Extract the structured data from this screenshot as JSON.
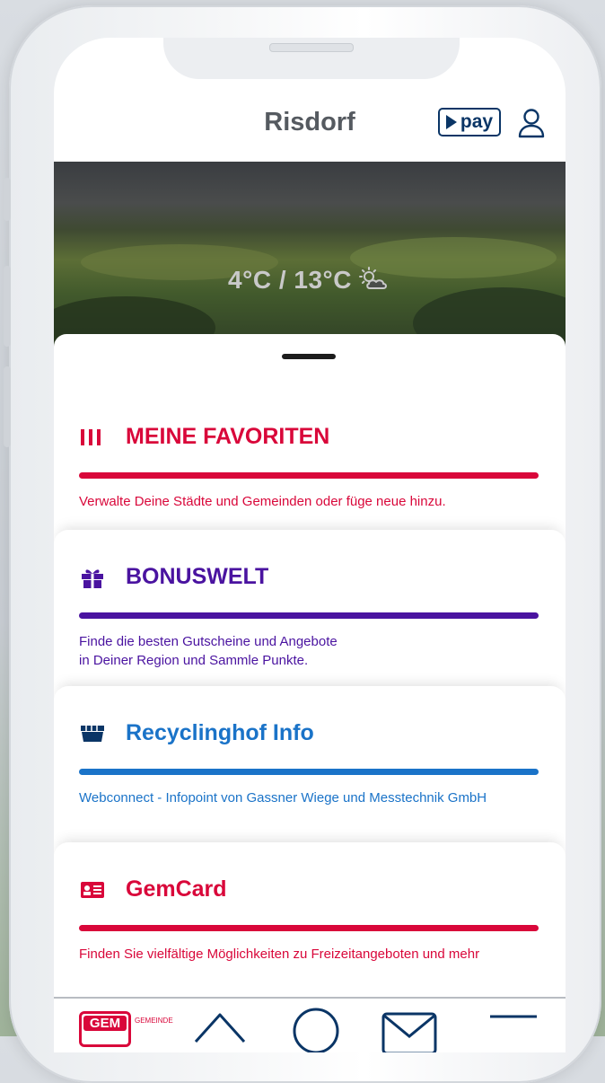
{
  "app": {
    "title": "Risdorf"
  },
  "header": {
    "pay_label": "pay"
  },
  "hero": {
    "temperature": "4°C / 13°C"
  },
  "cards": [
    {
      "title": "MEINE FAVORITEN",
      "description": "Verwalte Deine Städte und Gemeinden oder füge neue hinzu.",
      "color": "#d9073a",
      "icon": "favorites-bars-icon"
    },
    {
      "title": "BONUSWELT",
      "description": "Finde die besten Gutscheine und Angebote\nin Deiner Region und Sammle Punkte.",
      "color": "#4a13a0",
      "icon": "gift-icon"
    },
    {
      "title": "Recyclinghof Info",
      "description": "Webconnect - Infopoint von Gassner Wiege und Messtechnik GmbH",
      "color": "#1a73c8",
      "icon": "dumpster-icon"
    },
    {
      "title": "GemCard",
      "description": "Finden Sie vielfältige Möglichkeiten zu Freizeitangeboten und mehr",
      "color": "#d9073a",
      "icon": "id-card-icon"
    }
  ],
  "bottom_nav": {
    "logo_text": "GEM",
    "logo_subtext": "GEMEINDE",
    "items": [
      "home-icon",
      "search-icon",
      "mail-icon",
      "menu-icon"
    ]
  },
  "colors": {
    "brand_red": "#d9073a",
    "brand_purple": "#4a13a0",
    "brand_blue": "#1a73c8",
    "navy": "#0a3566"
  }
}
